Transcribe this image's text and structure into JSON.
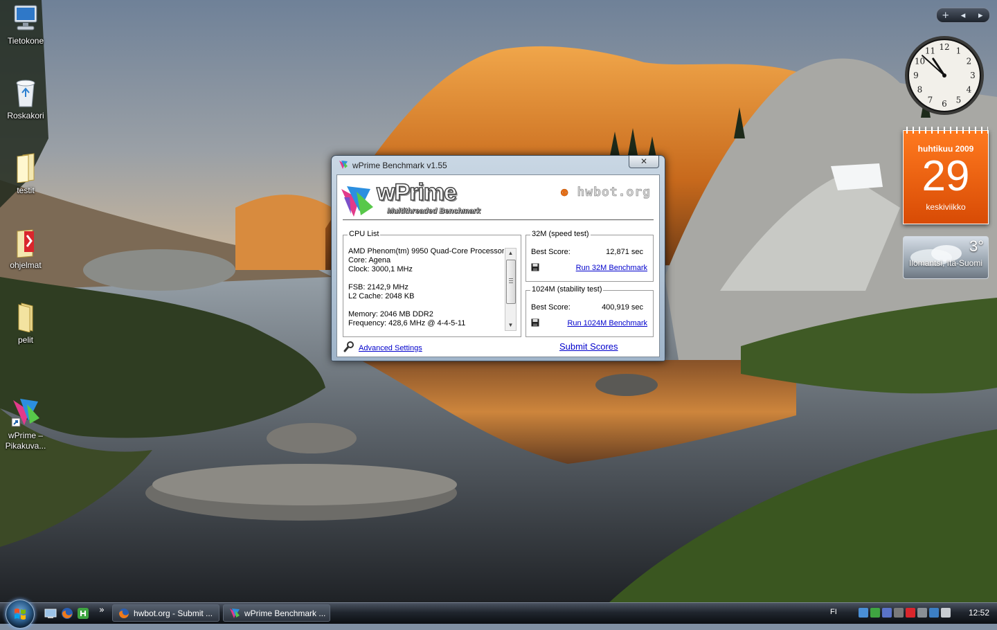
{
  "desktop": {
    "icons": [
      {
        "label": "Tietokone"
      },
      {
        "label": "Roskakori"
      },
      {
        "label": "testit"
      },
      {
        "label": "ohjelmat"
      },
      {
        "label": "pelit"
      },
      {
        "label": "wPrime –\nPikakuva..."
      }
    ]
  },
  "sidebar": {
    "controls": {
      "add": "+",
      "prev": "◂",
      "next": "▸"
    },
    "clock": {
      "hour": 10,
      "minute": 52
    },
    "calendar": {
      "month": "huhtikuu 2009",
      "day": "29",
      "weekday": "keskiviikko"
    },
    "weather": {
      "temp": "3°",
      "location": "Ilomantsi, Itä-Suomi"
    }
  },
  "window": {
    "title": "wPrime Benchmark v1.55",
    "close": "✕",
    "logo": {
      "name": "wPrime",
      "subtitle": "Multithreaded Benchmark",
      "sponsor_a": "hwbot",
      "sponsor_b": ".org"
    },
    "cpu_list": {
      "legend": "CPU List",
      "lines": [
        "AMD Phenom(tm) 9950 Quad-Core Processor",
        "Core: Agena",
        "Clock: 3000,1 MHz",
        "",
        "FSB: 2142,9 MHz",
        "L2 Cache: 2048 KB",
        "",
        "Memory: 2046 MB DDR2",
        "Frequency: 428,6 MHz @ 4-4-5-11"
      ]
    },
    "speed_test": {
      "legend": "32M (speed test)",
      "best_label": "Best Score:",
      "best_value": "12,871 sec",
      "run": "Run 32M Benchmark"
    },
    "stability_test": {
      "legend": "1024M (stability test)",
      "best_label": "Best Score:",
      "best_value": "400,919 sec",
      "run": "Run 1024M Benchmark"
    },
    "advanced": "Advanced Settings",
    "submit": "Submit Scores"
  },
  "taskbar": {
    "more": "»",
    "buttons": [
      {
        "label": "hwbot.org - Submit ..."
      },
      {
        "label": "wPrime Benchmark ..."
      }
    ],
    "language": "FI",
    "time": "12:52"
  },
  "colors": {
    "calendar": "#e8650f",
    "link": "#0000cc",
    "hwbot_accent": "#e56f17"
  }
}
